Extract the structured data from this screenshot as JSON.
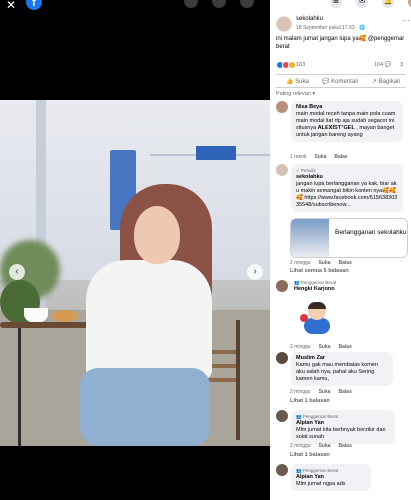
{
  "viewer": {
    "close_glyph": "✕",
    "logo_letter": "f",
    "prev_glyph": "‹",
    "next_glyph": "›"
  },
  "top_icons": {
    "grid_glyph": "⊞",
    "messenger_glyph": "✉",
    "bell_glyph": "🔔"
  },
  "post": {
    "author": "sekolahku",
    "date": "18 September pukul 17.53 · 🌐",
    "more": "···",
    "text": "ini malam jumat jangan lupa ya🥰 @penggemar berat",
    "reaction_count": "163",
    "comment_count": "104 💬",
    "share_count": "3"
  },
  "actions": {
    "like": "👍 Suka",
    "comment": "💬 Komentari",
    "share": "↗ Bagikan"
  },
  "filter_label": "Paling relevan ▾",
  "comments": [
    {
      "author": "Nisa Beya",
      "tag": "",
      "text": "main modal receh tanpa main pola cuam main modal liat rtp aja sudah segacor ini situsnya 𝐀𝐋𝐄𝐗𝐈𝐒𝐓*𝐆𝐄𝐋 , mayan banget untuk jangan bareng ayang",
      "time": "1 menit",
      "like": "Suka",
      "reply": "Balas"
    },
    {
      "author": "sekolahku",
      "tag": "✓ Penulis",
      "text": "jangan lupa berlangganan ya kak, biar aku makin semangat bikin konten nya🥰🥰🥰 https://www.facebook.com/61563830335548/subscribenow...",
      "time": "2 minggu",
      "like": "Suka",
      "reply": "Balas",
      "link_title": "Berlangganan sekolahku"
    },
    {
      "author": "Hengki Karjono",
      "tag": "👥 Penggemar Berat",
      "text": "",
      "time": "2 minggu",
      "like": "Suka",
      "reply": "Balas"
    },
    {
      "author": "Muslim Zar",
      "tag": "",
      "text": "Kamu gak mau membalas komen aku salah nya, pahal aku Sering kamen kamu,",
      "time": "2 minggu",
      "like": "Suka",
      "reply": "Balas"
    },
    {
      "author": "Alpian Yan",
      "tag": "👥 Penggemar Berat",
      "text": "Mlm jumat kita berbnyak berzikir dan solat sunah",
      "time": "2 minggu",
      "like": "Suka",
      "reply": "Balas"
    },
    {
      "author": "Alpian Yan",
      "tag": "👥 Penggemar Berat",
      "text": "Mlm jumat ngpa adx",
      "time": "",
      "like": "",
      "reply": ""
    }
  ],
  "replies": {
    "see_all": "Lihat semua 5 balasan",
    "one": "Lihat 1 balasan",
    "one_b": "Lihat 1 balasan"
  },
  "colors": {
    "fb_blue": "#1877f2",
    "like_blue": "#1877f2",
    "love_red": "#f33e58",
    "care_yellow": "#f7b125"
  }
}
